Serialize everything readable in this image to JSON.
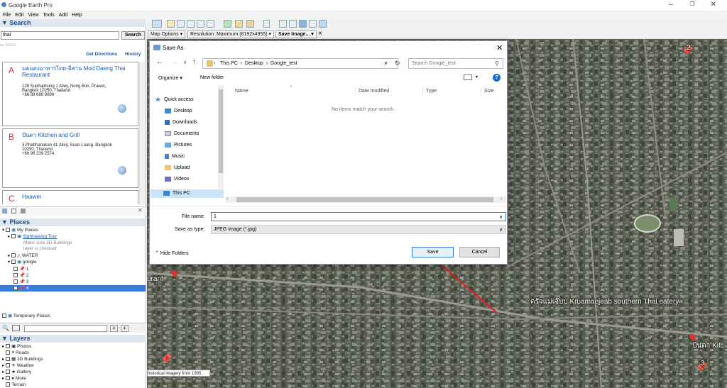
{
  "window": {
    "title": "Google Earth Pro"
  },
  "menu": [
    "File",
    "Edit",
    "View",
    "Tools",
    "Add",
    "Help"
  ],
  "search": {
    "header": "Search",
    "query": "thai",
    "button": "Search",
    "partial_text": "ec: 13213",
    "get_directions": "Get Directions",
    "history": "History",
    "results": [
      {
        "letter": "A",
        "name": "มดแดงอาหารไทย-อีสาน Mod Daeng Thai Restaurant",
        "address": [
          "128 Suphaphong 1 Alley, Nong Bon, Prawet,",
          "Bangkok 10250, Thailand",
          "+66 89 688 8898"
        ]
      },
      {
        "letter": "B",
        "name": "ปันตา Kitchen and Grill",
        "address": [
          "3 Phatthanakan 41 Alley, Suan Luang, Bangkok",
          "10250, Thailand",
          "+66 96 239 2574"
        ]
      },
      {
        "letter": "C",
        "name": "Haawm",
        "address": []
      }
    ]
  },
  "places": {
    "header": "Places",
    "items": [
      {
        "label": "My Places"
      },
      {
        "label": "Sightseeing Tour"
      },
      {
        "label": "Make sure 3D Buildings"
      },
      {
        "label": "layer is checked"
      },
      {
        "label": "WATER"
      },
      {
        "label": "google"
      },
      {
        "label": "1"
      },
      {
        "label": "2"
      },
      {
        "label": "3"
      },
      {
        "label": "4"
      },
      {
        "label": "Temporary Places"
      }
    ]
  },
  "layers": {
    "header": "Layers",
    "items": [
      "Photos",
      "Roads",
      "3D Buildings",
      "Weather",
      "Gallery",
      "More",
      "Terrain"
    ]
  },
  "options_bar": {
    "map_options": "Map Options",
    "resolution": "Resolution: Maximum (8192x4955)",
    "save_image": "Save Image...",
    "close": "×"
  },
  "dialog": {
    "title": "Save As",
    "breadcrumb": [
      "This PC",
      "Desktop",
      "Google_test"
    ],
    "search_placeholder": "Search Google_test",
    "organize": "Organize",
    "new_folder": "New folder",
    "nav_items": [
      "Quick access",
      "Desktop",
      "Downloads",
      "Documents",
      "Pictures",
      "Music",
      "Upload",
      "Videos",
      "This PC"
    ],
    "columns": [
      "Name",
      "Date modified",
      "Type",
      "Size"
    ],
    "empty_message": "No items match your search.",
    "file_name_label": "File name:",
    "file_name_value": "1",
    "save_as_type_label": "Save as type:",
    "save_as_type_value": "JPEG Image (*.jpg)",
    "hide_folders": "Hide Folders",
    "save": "Save",
    "cancel": "Cancel"
  },
  "map": {
    "labels": {
      "kruamaejeab": "ครัวแม่เจ๊บบ Kruamaejeab southern Thai eatery",
      "panta": "ปันตา Kitc",
      "urant": "urant",
      "tip": "historical imagery from 1985."
    },
    "pins": [
      "2",
      "3"
    ]
  },
  "colors": {
    "accent": "#1b4f8a",
    "selected": "#3a7bd5",
    "arrow": "#e21e1e"
  }
}
